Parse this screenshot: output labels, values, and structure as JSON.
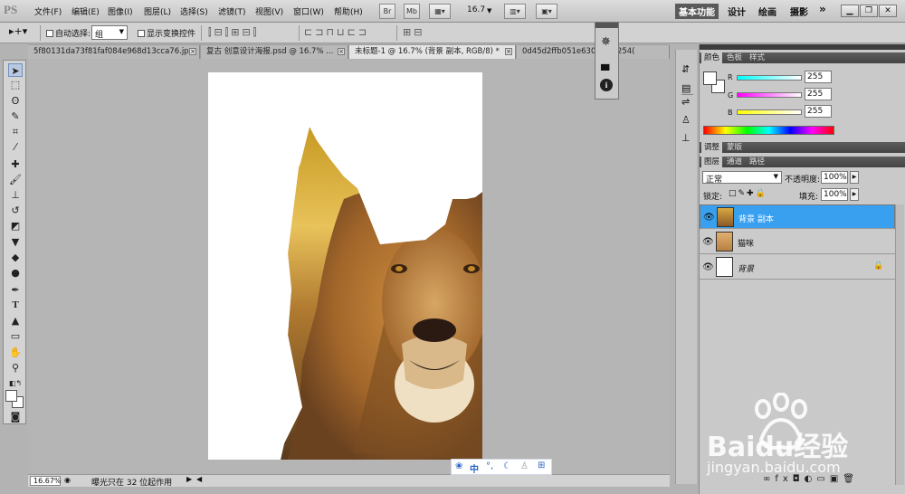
{
  "app": {
    "logo": "PS"
  },
  "menu": [
    "文件(F)",
    "编辑(E)",
    "图像(I)",
    "图层(L)",
    "选择(S)",
    "滤镜(T)",
    "视图(V)",
    "窗口(W)",
    "帮助(H)"
  ],
  "menubar": {
    "br_label": "Br",
    "mb_label": "Mb",
    "zoom": "16.7",
    "workspaces": [
      "基本功能",
      "设计",
      "绘画",
      "摄影"
    ],
    "more": "»"
  },
  "options": {
    "auto_select_label": "自动选择:",
    "auto_select_value": "组",
    "show_transform_label": "显示变换控件"
  },
  "tabs": [
    {
      "label": "5f80131da73f81faf084e968d13cca76.jpg",
      "active": false
    },
    {
      "label": "复古 创意设计海报.psd @ 16.7% ...",
      "active": false
    },
    {
      "label": "未标题-1 @ 16.7% (背景 副本, RGB/8) *",
      "active": true
    },
    {
      "label": "0d45d2ffb051e630f...f2c254(",
      "active": false
    }
  ],
  "status": {
    "zoom": "16.67%",
    "info": "曝光只在 32 位起作用"
  },
  "ime": {
    "label": "中"
  },
  "color_panel": {
    "tabs": [
      "颜色",
      "色板",
      "样式"
    ],
    "r_label": "R",
    "g_label": "G",
    "b_label": "B",
    "r": "255",
    "g": "255",
    "b": "255"
  },
  "adjust_panel": {
    "tabs": [
      "调整",
      "蒙版"
    ]
  },
  "layers_panel": {
    "tabs": [
      "图层",
      "通道",
      "路径"
    ],
    "blend_mode": "正常",
    "opacity_label": "不透明度:",
    "opacity": "100%",
    "lock_label": "锁定:",
    "fill_label": "填充:",
    "fill": "100%",
    "layers": [
      {
        "name": "背景 副本",
        "selected": true
      },
      {
        "name": "猫咪",
        "selected": false
      },
      {
        "name": "背景",
        "selected": false
      }
    ]
  },
  "watermark": {
    "text": "Baidu经验",
    "url": "jingyan.baidu.com"
  },
  "colors": {
    "selected_layer": "#39a0f0",
    "panel_header": "#4a4a4a"
  }
}
